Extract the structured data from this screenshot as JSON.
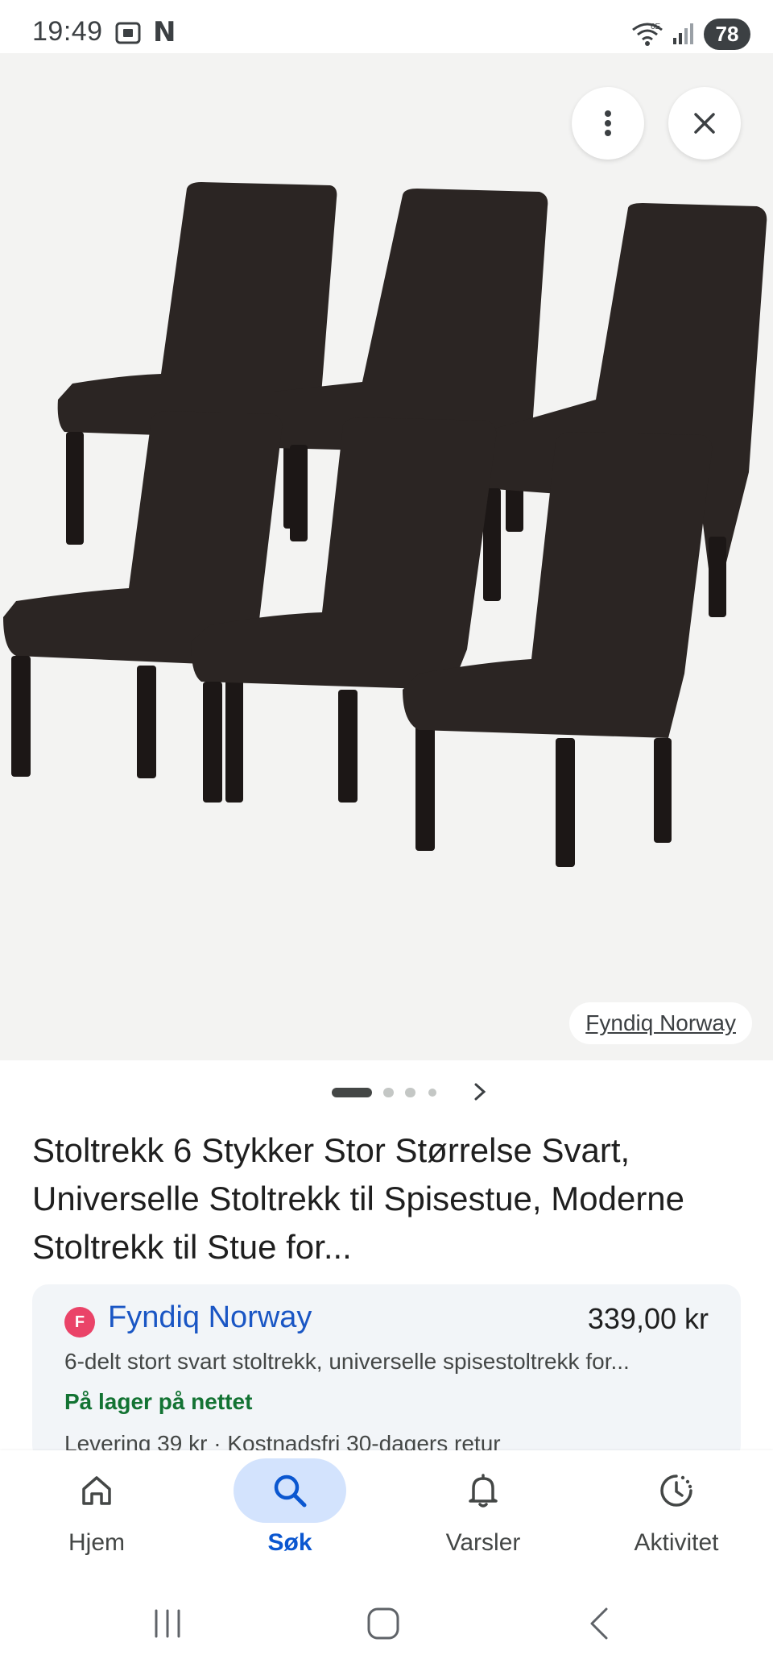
{
  "status_bar": {
    "time": "19:49",
    "network_label": "6E",
    "battery": "78"
  },
  "image_viewer": {
    "source_label": "Fyndiq Norway",
    "more_icon": "more-vert-icon",
    "close_icon": "close-icon",
    "carousel_count": 4,
    "carousel_active_index": 0
  },
  "product": {
    "title": "Stoltrekk 6 Stykker Stor Størrelse Svart, Universelle Stoltrekk til Spisestue, Moderne Stoltrekk til Stue for..."
  },
  "merchant": {
    "logo_letter": "F",
    "name": "Fyndiq Norway",
    "price": "339,00 kr",
    "description": "6-delt stort svart stoltrekk, universelle spisestoltrekk for...",
    "stock": "På lager på nettet",
    "delivery": "Levering 39 kr · Kostnadsfri 30-dagers retur",
    "colors": {
      "name": "#1a56c4",
      "stock": "#137333",
      "logo": "#ea4368"
    }
  },
  "bottom_nav": {
    "items": [
      {
        "label": "Hjem",
        "icon": "home-icon",
        "active": false
      },
      {
        "label": "Søk",
        "icon": "search-icon",
        "active": true
      },
      {
        "label": "Varsler",
        "icon": "bell-icon",
        "active": false
      },
      {
        "label": "Aktivitet",
        "icon": "activity-icon",
        "active": false
      }
    ]
  },
  "colors": {
    "accent": "#0b57d0",
    "active_pill": "#d3e3fd",
    "image_bg": "#f3f3f2"
  }
}
